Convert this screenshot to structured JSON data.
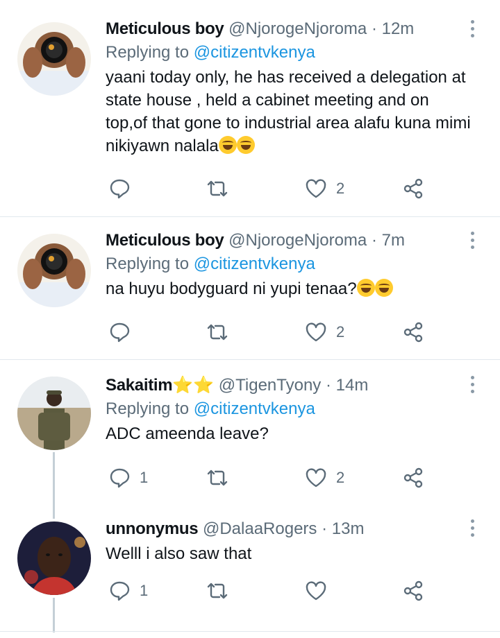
{
  "tweets": [
    {
      "name": "Meticulous boy",
      "stars": "",
      "handle": "@NjorogeNjoroma",
      "separator": "·",
      "time": "12m",
      "replying_prefix": "Replying to",
      "replying_to": "@citizentvkenya",
      "text": "yaani today only, he has received a delegation at state house , held a cabinet meeting and on top,of that gone to industrial area alafu kuna mimi nikiyawn nalala",
      "emoji": [
        "rofl-emoji",
        "rofl-emoji"
      ],
      "replies": "",
      "retweets": "",
      "likes": "2"
    },
    {
      "name": "Meticulous boy",
      "stars": "",
      "handle": "@NjorogeNjoroma",
      "separator": "·",
      "time": "7m",
      "replying_prefix": "Replying to",
      "replying_to": "@citizentvkenya",
      "text": "na huyu bodyguard ni yupi tenaa?",
      "emoji": [
        "joy-emoji",
        "joy-emoji"
      ],
      "replies": "",
      "retweets": "",
      "likes": "2"
    },
    {
      "name": "Sakaitim",
      "stars": "⭐⭐",
      "handle": "@TigenTyony",
      "separator": "·",
      "time": "14m",
      "replying_prefix": "Replying to",
      "replying_to": "@citizentvkenya",
      "text": "ADC ameenda leave?",
      "emoji": [],
      "replies": "1",
      "retweets": "",
      "likes": "2"
    },
    {
      "name": "unnonymus",
      "stars": "",
      "handle": "@DalaaRogers",
      "separator": "·",
      "time": "13m",
      "replying_prefix": "",
      "replying_to": "",
      "text": "Welll i also saw that",
      "emoji": [],
      "replies": "1",
      "retweets": "",
      "likes": ""
    }
  ],
  "icons": {
    "reply": "reply-icon",
    "retweet": "retweet-icon",
    "like": "heart-icon",
    "share": "share-icon",
    "menu": "more-vertical-icon"
  },
  "colors": {
    "link": "#1b95e0",
    "secondary_text": "#5b6b78",
    "icon": "#5b6b78",
    "divider": "#e1e8ed"
  }
}
